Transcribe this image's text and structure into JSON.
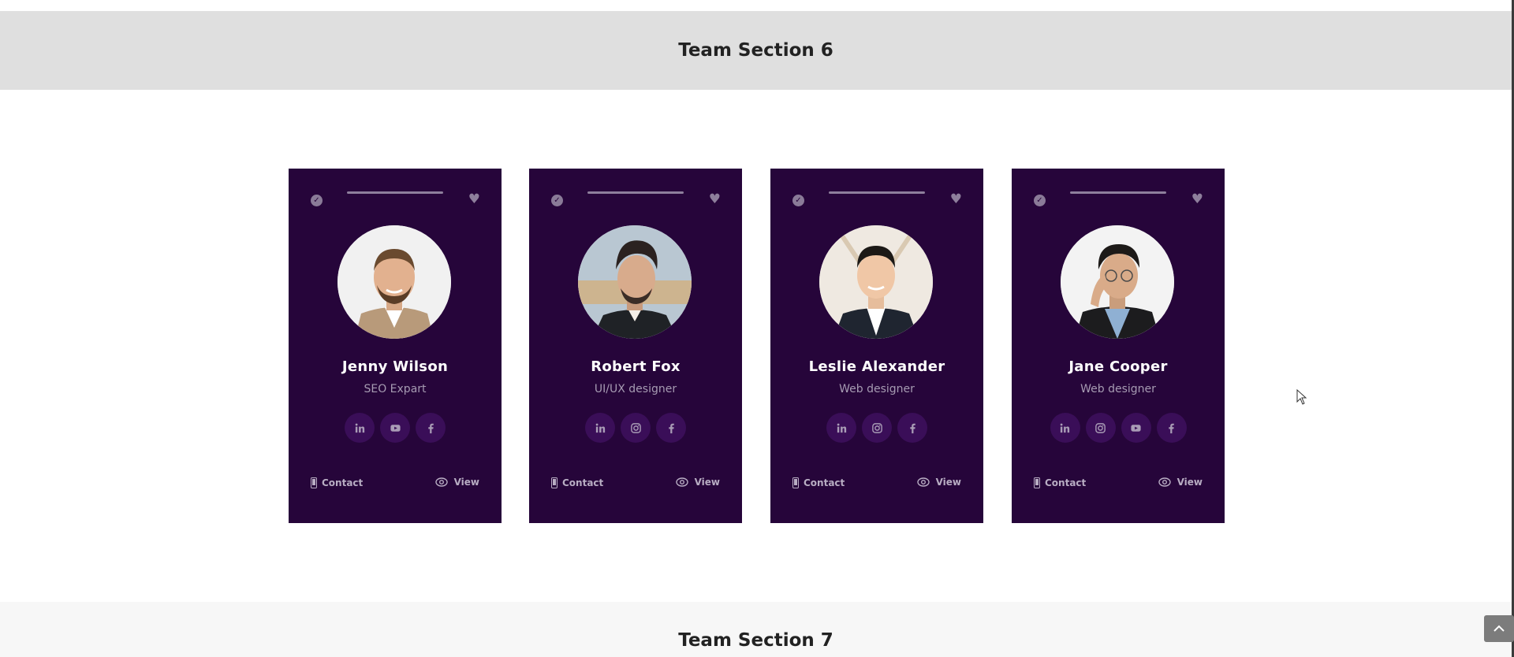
{
  "sections": {
    "current_title": "Team Section 6",
    "next_title": "Team Section 7"
  },
  "colors": {
    "card_bg": "#26053a",
    "header_bg": "#dfdfdf",
    "social_bg": "#3a0e58"
  },
  "cards": [
    {
      "name": "Jenny Wilson",
      "role": "SEO Expart",
      "socials": [
        "linkedin-icon",
        "youtube-icon",
        "facebook-icon"
      ],
      "contact_label": "Contact",
      "view_label": "View"
    },
    {
      "name": "Robert Fox",
      "role": "UI/UX designer",
      "socials": [
        "linkedin-icon",
        "instagram-icon",
        "facebook-icon"
      ],
      "contact_label": "Contact",
      "view_label": "View"
    },
    {
      "name": "Leslie Alexander",
      "role": "Web designer",
      "socials": [
        "linkedin-icon",
        "instagram-icon",
        "facebook-icon"
      ],
      "contact_label": "Contact",
      "view_label": "View"
    },
    {
      "name": "Jane Cooper",
      "role": "Web designer",
      "socials": [
        "linkedin-icon",
        "instagram-icon",
        "youtube-icon",
        "facebook-icon"
      ],
      "contact_label": "Contact",
      "view_label": "View"
    }
  ]
}
